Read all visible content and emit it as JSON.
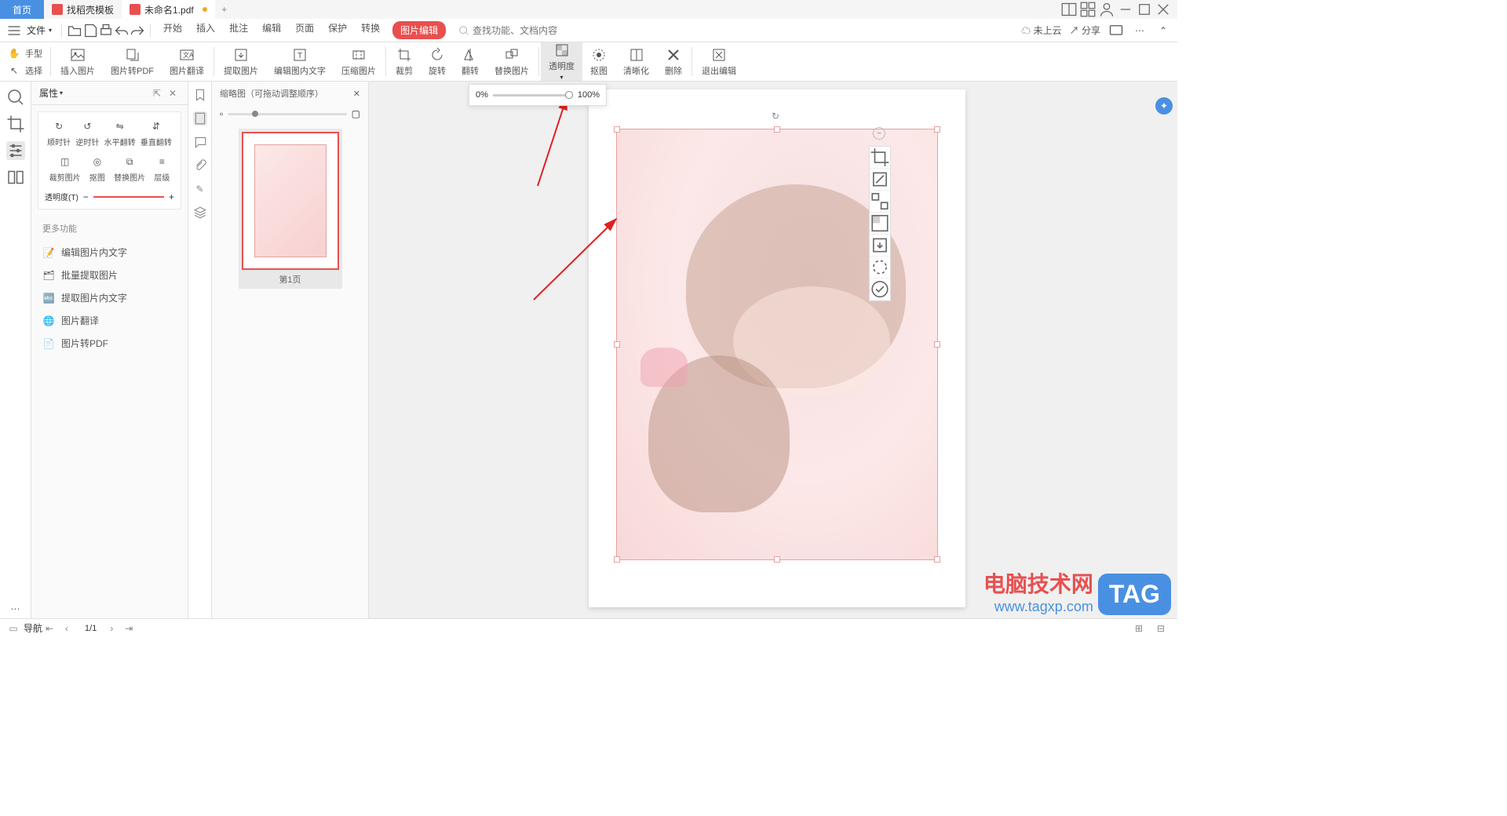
{
  "tabs": {
    "home": "首页",
    "t1": "找稻壳模板",
    "t2": "未命名1.pdf"
  },
  "filemenu": {
    "label": "文件"
  },
  "menutabs": [
    "开始",
    "插入",
    "批注",
    "编辑",
    "页面",
    "保护",
    "转换",
    "图片编辑"
  ],
  "search": {
    "placeholder": "查找功能、文档内容"
  },
  "menur": {
    "cloud": "未上云",
    "share": "分享"
  },
  "leftmode": {
    "hand": "手型",
    "select": "选择"
  },
  "tools": {
    "insert": "插入图片",
    "topdf": "图片转PDF",
    "translate": "图片翻译",
    "extract": "提取图片",
    "edittext": "编辑图内文字",
    "compress": "压缩图片",
    "crop": "裁剪",
    "rotate": "旋转",
    "flip": "翻转",
    "replace": "替换图片",
    "opacity": "透明度",
    "cutout": "抠图",
    "sharpen": "清晰化",
    "delete": "删除",
    "exit": "退出编辑"
  },
  "props": {
    "title": "属性",
    "cw": "顺时针",
    "ccw": "逆时针",
    "fliph": "水平翻转",
    "flipv": "垂直翻转",
    "cropimg": "裁剪图片",
    "cutout": "抠图",
    "replace": "替换图片",
    "layer": "层级",
    "opacity": "透明度(T)",
    "more": "更多功能",
    "m1": "编辑图片内文字",
    "m2": "批量提取图片",
    "m3": "提取图片内文字",
    "m4": "图片翻译",
    "m5": "图片转PDF"
  },
  "thumbs": {
    "title": "缩略图（可拖动调整顺序）",
    "page1": "第1页"
  },
  "opacity_pop": {
    "min": "0%",
    "max": "100%"
  },
  "status": {
    "nav": "导航",
    "page": "1/1"
  },
  "watermark": {
    "cn": "电脑技术网",
    "url": "www.tagxp.com",
    "tag": "TAG"
  }
}
